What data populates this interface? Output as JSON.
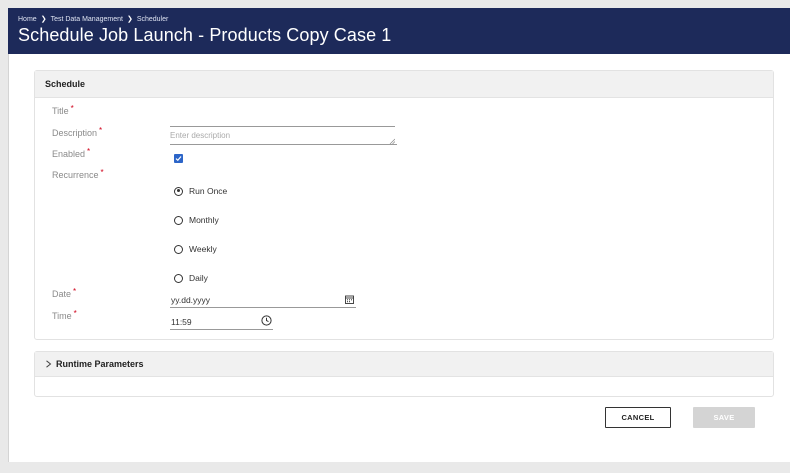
{
  "header": {
    "breadcrumbs": [
      "Home",
      "Test Data Management",
      "Scheduler"
    ],
    "title": "Schedule Job Launch - Products Copy Case 1"
  },
  "schedule": {
    "section_title": "Schedule",
    "fields": {
      "title_label": "Title",
      "description_label": "Description",
      "description_placeholder": "Enter description",
      "enabled_label": "Enabled",
      "enabled_checked": true,
      "recurrence_label": "Recurrence",
      "date_label": "Date",
      "date_placeholder": "yy.dd.yyyy",
      "time_label": "Time",
      "time_value": "11:59"
    },
    "recurrence_options": [
      {
        "label": "Run Once",
        "selected": true
      },
      {
        "label": "Monthly",
        "selected": false
      },
      {
        "label": "Weekly",
        "selected": false
      },
      {
        "label": "Daily",
        "selected": false
      }
    ],
    "required_mark": "*"
  },
  "runtime": {
    "section_title": "Runtime Parameters"
  },
  "actions": {
    "cancel_label": "CANCEL",
    "save_label": "SAVE"
  },
  "colors": {
    "header_bg": "#1d2a5a",
    "accent": "#2c65c8",
    "required": "#d0021b"
  }
}
